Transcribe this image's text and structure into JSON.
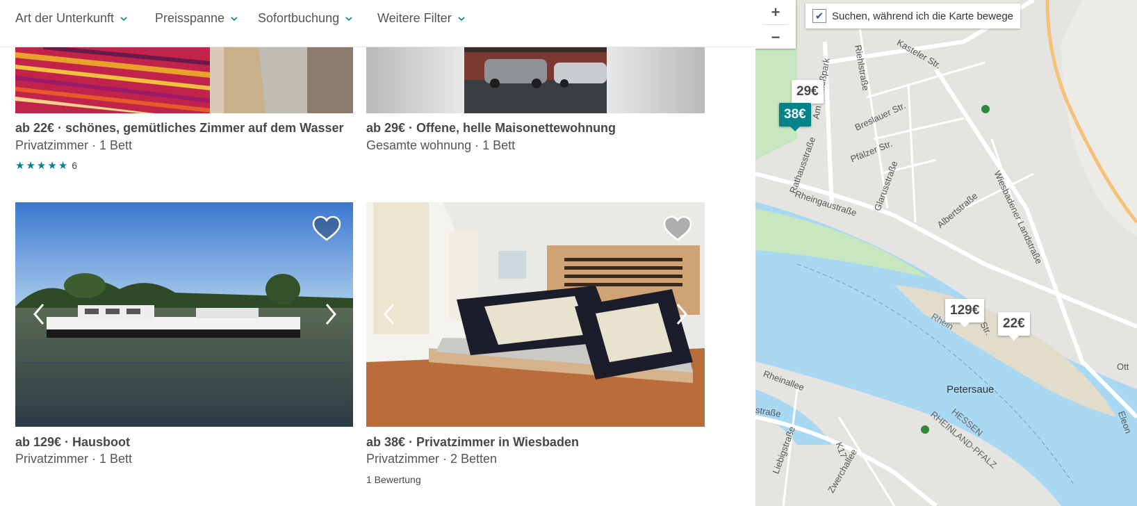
{
  "filters": [
    "Art der Unterkunft",
    "Preisspanne",
    "Sofortbuchung",
    "Weitere Filter"
  ],
  "listings": [
    {
      "title": "ab 22€ · schönes, gemütliches Zimmer auf dem Wasser",
      "subtitle": "Privatzimmer · 1 Bett",
      "rating": 5,
      "reviews": "6"
    },
    {
      "title": "ab 29€ · Offene, helle Maisonettewohnung",
      "subtitle": "Gesamte wohnung · 1 Bett"
    },
    {
      "title": "ab 129€ · Hausboot",
      "subtitle": "Privatzimmer · 1 Bett"
    },
    {
      "title": "ab 38€ · Privatzimmer in Wiesbaden",
      "subtitle": "Privatzimmer · 2 Betten",
      "reviews": "1 Bewertung"
    }
  ],
  "map": {
    "zoom_in": "+",
    "zoom_out": "−",
    "search_move_label": "Suchen, während ich die Karte bewege",
    "search_move_checked": true,
    "pins": [
      {
        "label": "29€",
        "active": false
      },
      {
        "label": "38€",
        "active": true
      },
      {
        "label": "129€",
        "active": false
      },
      {
        "label": "22€",
        "active": false
      }
    ],
    "labels": {
      "kasteler": "Kasteler Str.",
      "breslauer": "Breslauer Str.",
      "pfaelzer": "Pfälzer Str.",
      "rheingau": "Rheingaustraße",
      "glarus": "Glarusstraße",
      "rathaus": "Rathausstraße",
      "schloss": "Am Schloßpark",
      "riehl": "Riehlstraße",
      "albert": "Albertstraße",
      "wiesbadener": "Wiesbadener Landstraße",
      "rhein": "Rhein",
      "rheinallee": "Rheinallee",
      "liebig": "Liebigstraße",
      "k17": "K17",
      "zwerch": "Zwerchallee",
      "petersaue": "Petersaue",
      "hessen": "HESSEN",
      "rlp": "RHEINLAND-PFALZ",
      "strasse": "straße",
      "ott": "Ott",
      "eleon": "Eleon",
      "str": "Str."
    }
  },
  "colors": {
    "accent": "#00848a",
    "water": "#a9d8f3",
    "land": "#e6e4e0",
    "park": "#c8e6c0",
    "highway": "#f6c277"
  }
}
